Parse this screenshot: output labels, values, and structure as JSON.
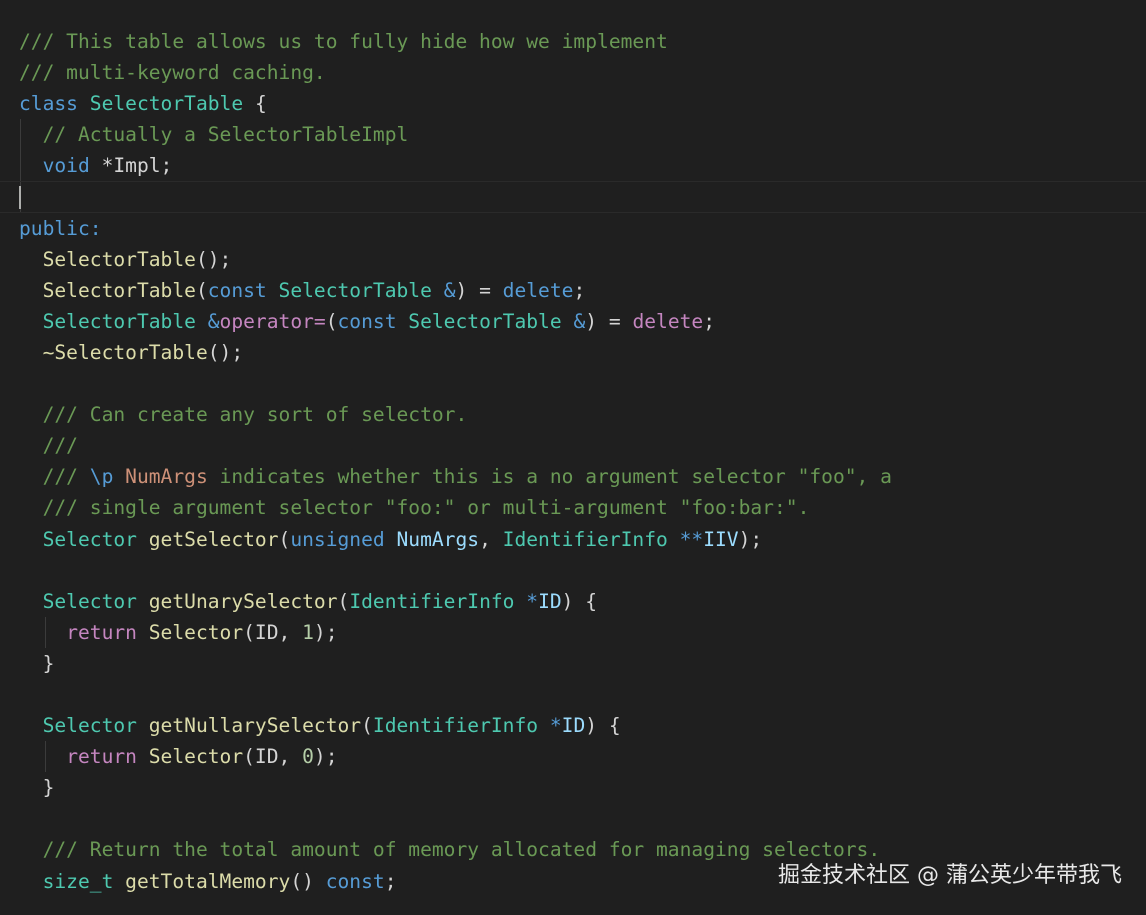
{
  "editor": {
    "lines": [
      [
        {
          "t": "/// This table allows us to fully hide how we implement",
          "c": "comment"
        }
      ],
      [
        {
          "t": "/// multi-keyword caching.",
          "c": "comment"
        }
      ],
      [
        {
          "t": "class",
          "c": "kw"
        },
        {
          "t": " ",
          "c": "plain"
        },
        {
          "t": "SelectorTable",
          "c": "type"
        },
        {
          "t": " ",
          "c": "plain"
        },
        {
          "t": "{",
          "c": "plain"
        }
      ],
      [
        {
          "t": "  ",
          "c": "plain"
        },
        {
          "t": "// Actually a SelectorTableImpl",
          "c": "comment"
        }
      ],
      [
        {
          "t": "  ",
          "c": "plain"
        },
        {
          "t": "void",
          "c": "kw"
        },
        {
          "t": " *Impl;",
          "c": "plain"
        }
      ],
      [],
      [
        {
          "t": "public:",
          "c": "kw"
        }
      ],
      [
        {
          "t": "  ",
          "c": "plain"
        },
        {
          "t": "SelectorTable",
          "c": "fn"
        },
        {
          "t": "();",
          "c": "plain"
        }
      ],
      [
        {
          "t": "  ",
          "c": "plain"
        },
        {
          "t": "SelectorTable",
          "c": "fn"
        },
        {
          "t": "(",
          "c": "plain"
        },
        {
          "t": "const",
          "c": "kw"
        },
        {
          "t": " ",
          "c": "plain"
        },
        {
          "t": "SelectorTable",
          "c": "type"
        },
        {
          "t": " ",
          "c": "plain"
        },
        {
          "t": "&",
          "c": "kw"
        },
        {
          "t": ") = ",
          "c": "plain"
        },
        {
          "t": "delete",
          "c": "kw"
        },
        {
          "t": ";",
          "c": "plain"
        }
      ],
      [
        {
          "t": "  ",
          "c": "plain"
        },
        {
          "t": "SelectorTable",
          "c": "type"
        },
        {
          "t": " ",
          "c": "plain"
        },
        {
          "t": "&",
          "c": "kw"
        },
        {
          "t": "operator=",
          "c": "ctrl"
        },
        {
          "t": "(",
          "c": "plain"
        },
        {
          "t": "const",
          "c": "kw"
        },
        {
          "t": " ",
          "c": "plain"
        },
        {
          "t": "SelectorTable",
          "c": "type"
        },
        {
          "t": " ",
          "c": "plain"
        },
        {
          "t": "&",
          "c": "kw"
        },
        {
          "t": ") = ",
          "c": "plain"
        },
        {
          "t": "delete",
          "c": "ctrl"
        },
        {
          "t": ";",
          "c": "plain"
        }
      ],
      [
        {
          "t": "  ",
          "c": "plain"
        },
        {
          "t": "~SelectorTable",
          "c": "fn"
        },
        {
          "t": "();",
          "c": "plain"
        }
      ],
      [],
      [
        {
          "t": "  ",
          "c": "plain"
        },
        {
          "t": "/// Can create any sort of selector.",
          "c": "comment"
        }
      ],
      [
        {
          "t": "  ",
          "c": "plain"
        },
        {
          "t": "///",
          "c": "comment"
        }
      ],
      [
        {
          "t": "  ",
          "c": "plain"
        },
        {
          "t": "/// ",
          "c": "comment"
        },
        {
          "t": "\\p",
          "c": "doctag"
        },
        {
          "t": " ",
          "c": "comment"
        },
        {
          "t": "NumArgs",
          "c": "docparam"
        },
        {
          "t": " indicates whether this is a no argument selector \"foo\", a",
          "c": "comment"
        }
      ],
      [
        {
          "t": "  ",
          "c": "plain"
        },
        {
          "t": "/// single argument selector \"foo:\" or multi-argument \"foo:bar:\".",
          "c": "comment"
        }
      ],
      [
        {
          "t": "  ",
          "c": "plain"
        },
        {
          "t": "Selector",
          "c": "type"
        },
        {
          "t": " ",
          "c": "plain"
        },
        {
          "t": "getSelector",
          "c": "fn"
        },
        {
          "t": "(",
          "c": "plain"
        },
        {
          "t": "unsigned",
          "c": "kw"
        },
        {
          "t": " ",
          "c": "plain"
        },
        {
          "t": "NumArgs",
          "c": "var"
        },
        {
          "t": ", ",
          "c": "plain"
        },
        {
          "t": "IdentifierInfo",
          "c": "type"
        },
        {
          "t": " ",
          "c": "plain"
        },
        {
          "t": "**",
          "c": "kw"
        },
        {
          "t": "IIV",
          "c": "var"
        },
        {
          "t": ");",
          "c": "plain"
        }
      ],
      [],
      [
        {
          "t": "  ",
          "c": "plain"
        },
        {
          "t": "Selector",
          "c": "type"
        },
        {
          "t": " ",
          "c": "plain"
        },
        {
          "t": "getUnarySelector",
          "c": "fn"
        },
        {
          "t": "(",
          "c": "plain"
        },
        {
          "t": "IdentifierInfo",
          "c": "type"
        },
        {
          "t": " ",
          "c": "plain"
        },
        {
          "t": "*",
          "c": "kw"
        },
        {
          "t": "ID",
          "c": "var"
        },
        {
          "t": ") {",
          "c": "plain"
        }
      ],
      [
        {
          "t": "    ",
          "c": "plain"
        },
        {
          "t": "return",
          "c": "ctrl"
        },
        {
          "t": " ",
          "c": "plain"
        },
        {
          "t": "Selector",
          "c": "fn"
        },
        {
          "t": "(ID, ",
          "c": "plain"
        },
        {
          "t": "1",
          "c": "num"
        },
        {
          "t": ");",
          "c": "plain"
        }
      ],
      [
        {
          "t": "  }",
          "c": "plain"
        }
      ],
      [],
      [
        {
          "t": "  ",
          "c": "plain"
        },
        {
          "t": "Selector",
          "c": "type"
        },
        {
          "t": " ",
          "c": "plain"
        },
        {
          "t": "getNullarySelector",
          "c": "fn"
        },
        {
          "t": "(",
          "c": "plain"
        },
        {
          "t": "IdentifierInfo",
          "c": "type"
        },
        {
          "t": " ",
          "c": "plain"
        },
        {
          "t": "*",
          "c": "kw"
        },
        {
          "t": "ID",
          "c": "var"
        },
        {
          "t": ") {",
          "c": "plain"
        }
      ],
      [
        {
          "t": "    ",
          "c": "plain"
        },
        {
          "t": "return",
          "c": "ctrl"
        },
        {
          "t": " ",
          "c": "plain"
        },
        {
          "t": "Selector",
          "c": "fn"
        },
        {
          "t": "(ID, ",
          "c": "plain"
        },
        {
          "t": "0",
          "c": "num"
        },
        {
          "t": ");",
          "c": "plain"
        }
      ],
      [
        {
          "t": "  }",
          "c": "plain"
        }
      ],
      [],
      [
        {
          "t": "  ",
          "c": "plain"
        },
        {
          "t": "/// Return the total amount of memory allocated for managing selectors.",
          "c": "comment"
        }
      ],
      [
        {
          "t": "  ",
          "c": "plain"
        },
        {
          "t": "size_t",
          "c": "type"
        },
        {
          "t": " ",
          "c": "plain"
        },
        {
          "t": "getTotalMemory",
          "c": "fn"
        },
        {
          "t": "() ",
          "c": "plain"
        },
        {
          "t": "const",
          "c": "kw"
        },
        {
          "t": ";",
          "c": "plain"
        }
      ]
    ],
    "current_line": 5,
    "colors": {
      "background": "#1f1f1f",
      "comment": "#6a9955",
      "keyword": "#569cd6",
      "type": "#4ec9b0",
      "function": "#dcdcaa",
      "control": "#c586c0",
      "variable": "#9cdcfe",
      "number": "#b5cea8",
      "text": "#d4d4d4"
    }
  },
  "watermark": {
    "text": "掘金技术社区 @ 蒲公英少年带我飞"
  }
}
